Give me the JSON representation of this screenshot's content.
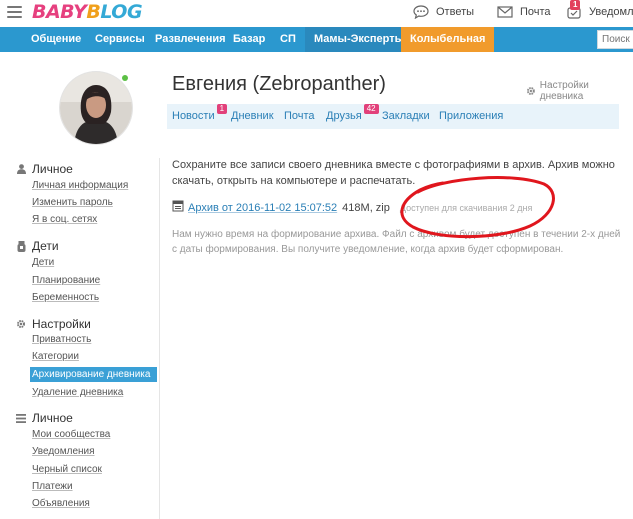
{
  "header": {
    "logo": {
      "part1": "BABY",
      "part2": "B",
      "part3": "LOG"
    },
    "answers_label": "Ответы",
    "mail_label": "Почта",
    "notifications_label": "Уведомл",
    "notifications_count": "1"
  },
  "menu": {
    "items": [
      "Общение",
      "Сервисы",
      "Развлечения",
      "Базар",
      "СП",
      "Мамы-Эксперты",
      "Колыбельная"
    ],
    "search_placeholder": "Поиск п"
  },
  "profile": {
    "name": "Евгения (Zebropanther)",
    "settings_label": "Настройки дневника",
    "tabs": [
      {
        "label": "Новости",
        "badge": "1"
      },
      {
        "label": "Дневник"
      },
      {
        "label": "Почта"
      },
      {
        "label": "Друзья",
        "badge": "42"
      },
      {
        "label": "Закладки"
      },
      {
        "label": "Приложения"
      }
    ]
  },
  "sidebar": {
    "sections": [
      {
        "title": "Личное",
        "icon": "person-icon",
        "items": [
          "Личная информация",
          "Изменить пароль",
          "Я в соц. сетях"
        ]
      },
      {
        "title": "Дети",
        "icon": "baby-icon",
        "items": [
          "Дети",
          "Планирование",
          "Беременность"
        ]
      },
      {
        "title": "Настройки",
        "icon": "gear-icon",
        "items": [
          "Приватность",
          "Категории",
          "Архивирование дневника",
          "Удаление дневника"
        ]
      },
      {
        "title": "Личное",
        "icon": "list-icon",
        "items": [
          "Мои сообщества",
          "Уведомления",
          "Черный список",
          "Платежи",
          "Объявления"
        ]
      }
    ],
    "active_item": "Архивирование дневника"
  },
  "main": {
    "intro_text": "Сохраните все записи своего дневника вместе с фотографиями в архив. Архив можно скачать, открыть на компьютере и распечатать.",
    "archive": {
      "link_label": "Архив от 2016-11-02 15:07:52",
      "size": "418M, zip",
      "status": "Доступен для скачивания 2 дня"
    },
    "info_text": "Нам нужно время на формирование архива. Файл с архивом будет доступен в течении 2-х дней с даты формирования. Вы получите уведомление, когда архив будет сформирован."
  },
  "colors": {
    "brand_blue": "#2b98cf",
    "accent_orange": "#f19b2c",
    "experts_blue": "#2a89bd",
    "badge_pink": "#e2407a",
    "annotation_red": "#e0161d"
  }
}
